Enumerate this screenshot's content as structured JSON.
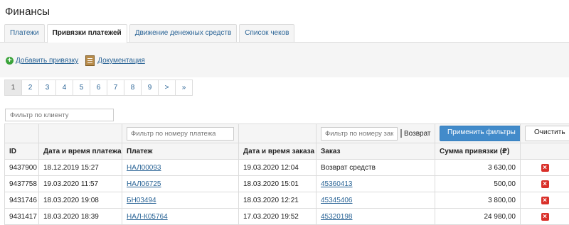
{
  "page": {
    "title": "Финансы"
  },
  "tabs": [
    {
      "label": "Платежи"
    },
    {
      "label": "Привязки платежей"
    },
    {
      "label": "Движение денежных средств"
    },
    {
      "label": "Список чеков"
    }
  ],
  "actions": {
    "add_link": "Добавить привязку",
    "docs_link": "Документация"
  },
  "pager": [
    "1",
    "2",
    "3",
    "4",
    "5",
    "6",
    "7",
    "8",
    "9",
    ">",
    "»"
  ],
  "filters": {
    "client_placeholder": "Фильтр по клиенту",
    "payment_placeholder": "Фильтр по номеру платежа",
    "order_placeholder": "Фильтр по номеру заказа",
    "refund_label": "Возврат",
    "apply_label": "Применить фильтры",
    "clear_label": "Очистить"
  },
  "columns": [
    "ID",
    "Дата и время платежа",
    "Платеж",
    "Дата и время заказа",
    "Заказ",
    "Сумма привязки (₽)"
  ],
  "rows": [
    {
      "id": "9437900",
      "pay_date": "18.12.2019 15:27",
      "payment": "НАЛ00093",
      "order_date": "19.03.2020 12:04",
      "order": "Возврат средств",
      "sum": "3 630,00"
    },
    {
      "id": "9437758",
      "pay_date": "19.03.2020 11:57",
      "payment": "НАЛ06725",
      "order_date": "18.03.2020 15:01",
      "order": "45360413",
      "sum": "500,00"
    },
    {
      "id": "9431746",
      "pay_date": "18.03.2020 19:08",
      "payment": "БН03494",
      "order_date": "18.03.2020 12:21",
      "order": "45345406",
      "sum": "3 800,00"
    },
    {
      "id": "9431417",
      "pay_date": "18.03.2020 18:39",
      "payment": "НАЛ-К05764",
      "order_date": "17.03.2020 19:52",
      "order": "45320198",
      "sum": "24 980,00"
    }
  ],
  "colors": {
    "link": "#2a6496",
    "apply_button": "#428bca",
    "delete_icon": "#d9302a",
    "add_icon": "#3aa33a"
  }
}
